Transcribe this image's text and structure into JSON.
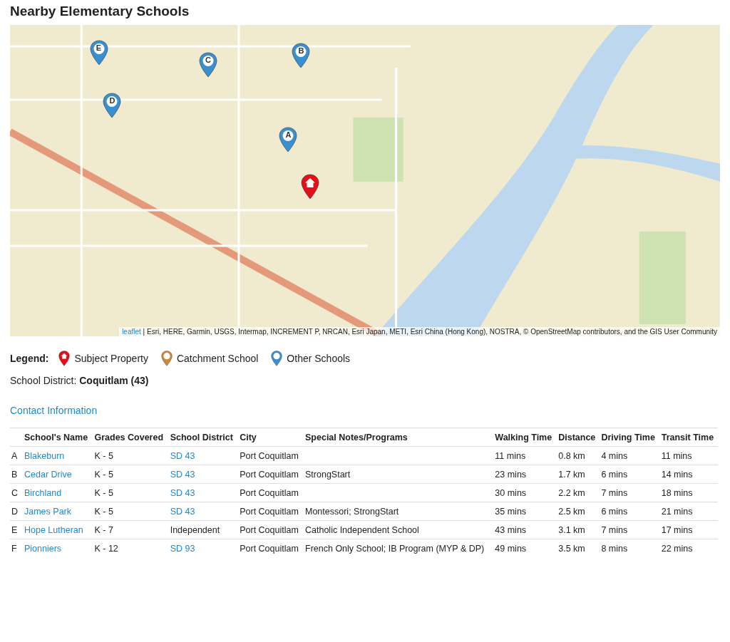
{
  "title": "Nearby Elementary Schools",
  "map": {
    "pins": [
      {
        "kind": "school",
        "label": "E"
      },
      {
        "kind": "school",
        "label": "C"
      },
      {
        "kind": "school",
        "label": "B"
      },
      {
        "kind": "school",
        "label": "D"
      },
      {
        "kind": "school",
        "label": "A"
      },
      {
        "kind": "subject"
      }
    ],
    "attribution_link": "leaflet",
    "attribution": "| Esri, HERE, Garmin, USGS, Intermap, INCREMENT P, NRCAN, Esri Japan, METI, Esri China (Hong Kong), NOSTRA, © OpenStreetMap contributors, and the GIS User Community"
  },
  "legend": {
    "label": "Legend:",
    "items": [
      {
        "kind": "subject",
        "label": "Subject Property"
      },
      {
        "kind": "catchment",
        "label": "Catchment School"
      },
      {
        "kind": "other",
        "label": "Other Schools"
      }
    ]
  },
  "district": "School District: **Coquitlam (43)**",
  "contact_link": "Contact Information",
  "table": {
    "columns": [
      "School's Name",
      "Grades Covered",
      "School District",
      "City",
      "Special Notes/Programs",
      "Walking Time",
      "Distance",
      "Driving Time",
      "Transit Time"
    ],
    "rows": [
      {
        "letter": "A",
        "name": "Blakeburn",
        "grades": "K - 5",
        "district": "SD 43",
        "district_link": true,
        "city": "Port Coquitlam",
        "walking": "11 mins",
        "distance": "0.8 km",
        "driving": "4 mins",
        "transit": "11 mins"
      },
      {
        "letter": "B",
        "name": "Cedar Drive",
        "grades": "K - 5",
        "district": "SD 43",
        "district_link": true,
        "city": "Port Coquitlam",
        "notes": "StrongStart",
        "walking": "23 mins",
        "distance": "1.7 km",
        "driving": "6 mins",
        "transit": "14 mins"
      },
      {
        "letter": "C",
        "name": "Birchland",
        "grades": "K - 5",
        "district": "SD 43",
        "district_link": true,
        "city": "Port Coquitlam",
        "walking": "30 mins",
        "distance": "2.2 km",
        "driving": "7 mins",
        "transit": "18 mins"
      },
      {
        "letter": "D",
        "name": "James Park",
        "grades": "K - 5",
        "district": "SD 43",
        "district_link": true,
        "city": "Port Coquitlam",
        "notes": "Montessori; StrongStart",
        "walking": "35 mins",
        "distance": "2.5 km",
        "driving": "6 mins",
        "transit": "21 mins"
      },
      {
        "letter": "E",
        "name": "Hope Lutheran",
        "grades": "K - 7",
        "district": "Independent",
        "district_link": false,
        "city": "Port Coquitlam",
        "notes": "Catholic Independent School",
        "walking": "43 mins",
        "distance": "3.1 km",
        "driving": "7 mins",
        "transit": "17 mins"
      },
      {
        "letter": "F",
        "name": "Pionniers",
        "grades": "K - 12",
        "district": "SD 93",
        "district_link": true,
        "city": "Port Coquitlam",
        "notes": "French Only School; IB Program (MYP & DP)",
        "walking": "49 mins",
        "distance": "3.5 km",
        "driving": "8 mins",
        "transit": "22 mins"
      }
    ]
  }
}
